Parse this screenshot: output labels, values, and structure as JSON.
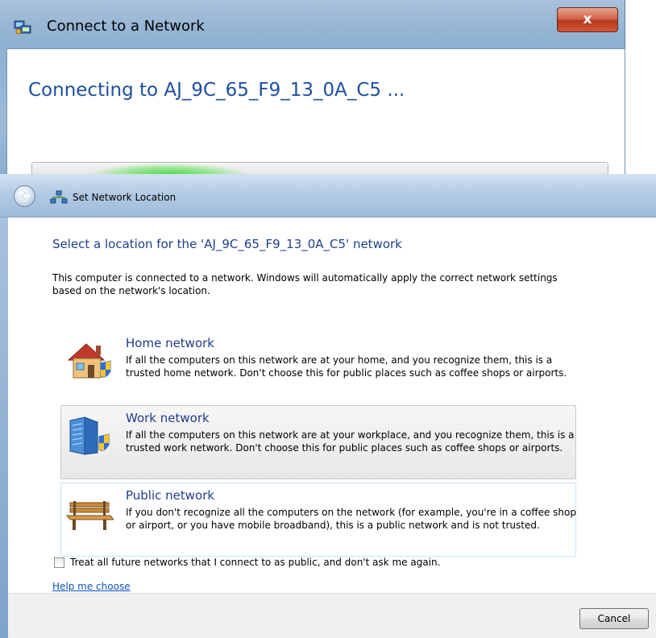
{
  "connect_window": {
    "title": "Connect to a Network",
    "close_glyph": "x",
    "heading": "Connecting to AJ_9C_65_F9_13_0A_C5 ...",
    "title_icon": "network-connect-icon"
  },
  "location_window": {
    "title": "Set Network Location",
    "back_icon": "back-arrow-icon",
    "title_icon": "network-icon",
    "heading": "Select a location for the 'AJ_9C_65_F9_13_0A_C5' network",
    "description": "This computer is connected to a network. Windows will automatically apply the correct network settings based on the network's location.",
    "options": [
      {
        "title": "Home network",
        "description": "If all the computers on this network are at your home, and you recognize them, this is a trusted home network.  Don't choose this for public places such as coffee shops or airports.",
        "icon": "house-icon"
      },
      {
        "title": "Work network",
        "description": "If all the computers on this network are at your workplace, and you recognize them, this is a trusted work network.  Don't choose this for public places such as coffee shops or airports.",
        "icon": "office-building-icon"
      },
      {
        "title": "Public network",
        "description": "If you don't recognize all the computers on the network (for example, you're in a coffee shop or airport, or you have mobile broadband), this is a public network and is not trusted.",
        "icon": "park-bench-icon"
      }
    ],
    "checkbox_label": "Treat all future networks that I connect to as public, and don't ask me again.",
    "checkbox_checked": false,
    "help_link": "Help me choose",
    "cancel_label": "Cancel"
  },
  "colors": {
    "heading_blue": "#1e3f8c",
    "link_blue": "#0a53c1",
    "close_red": "#c7472a",
    "progress_green": "#4fd84a"
  }
}
